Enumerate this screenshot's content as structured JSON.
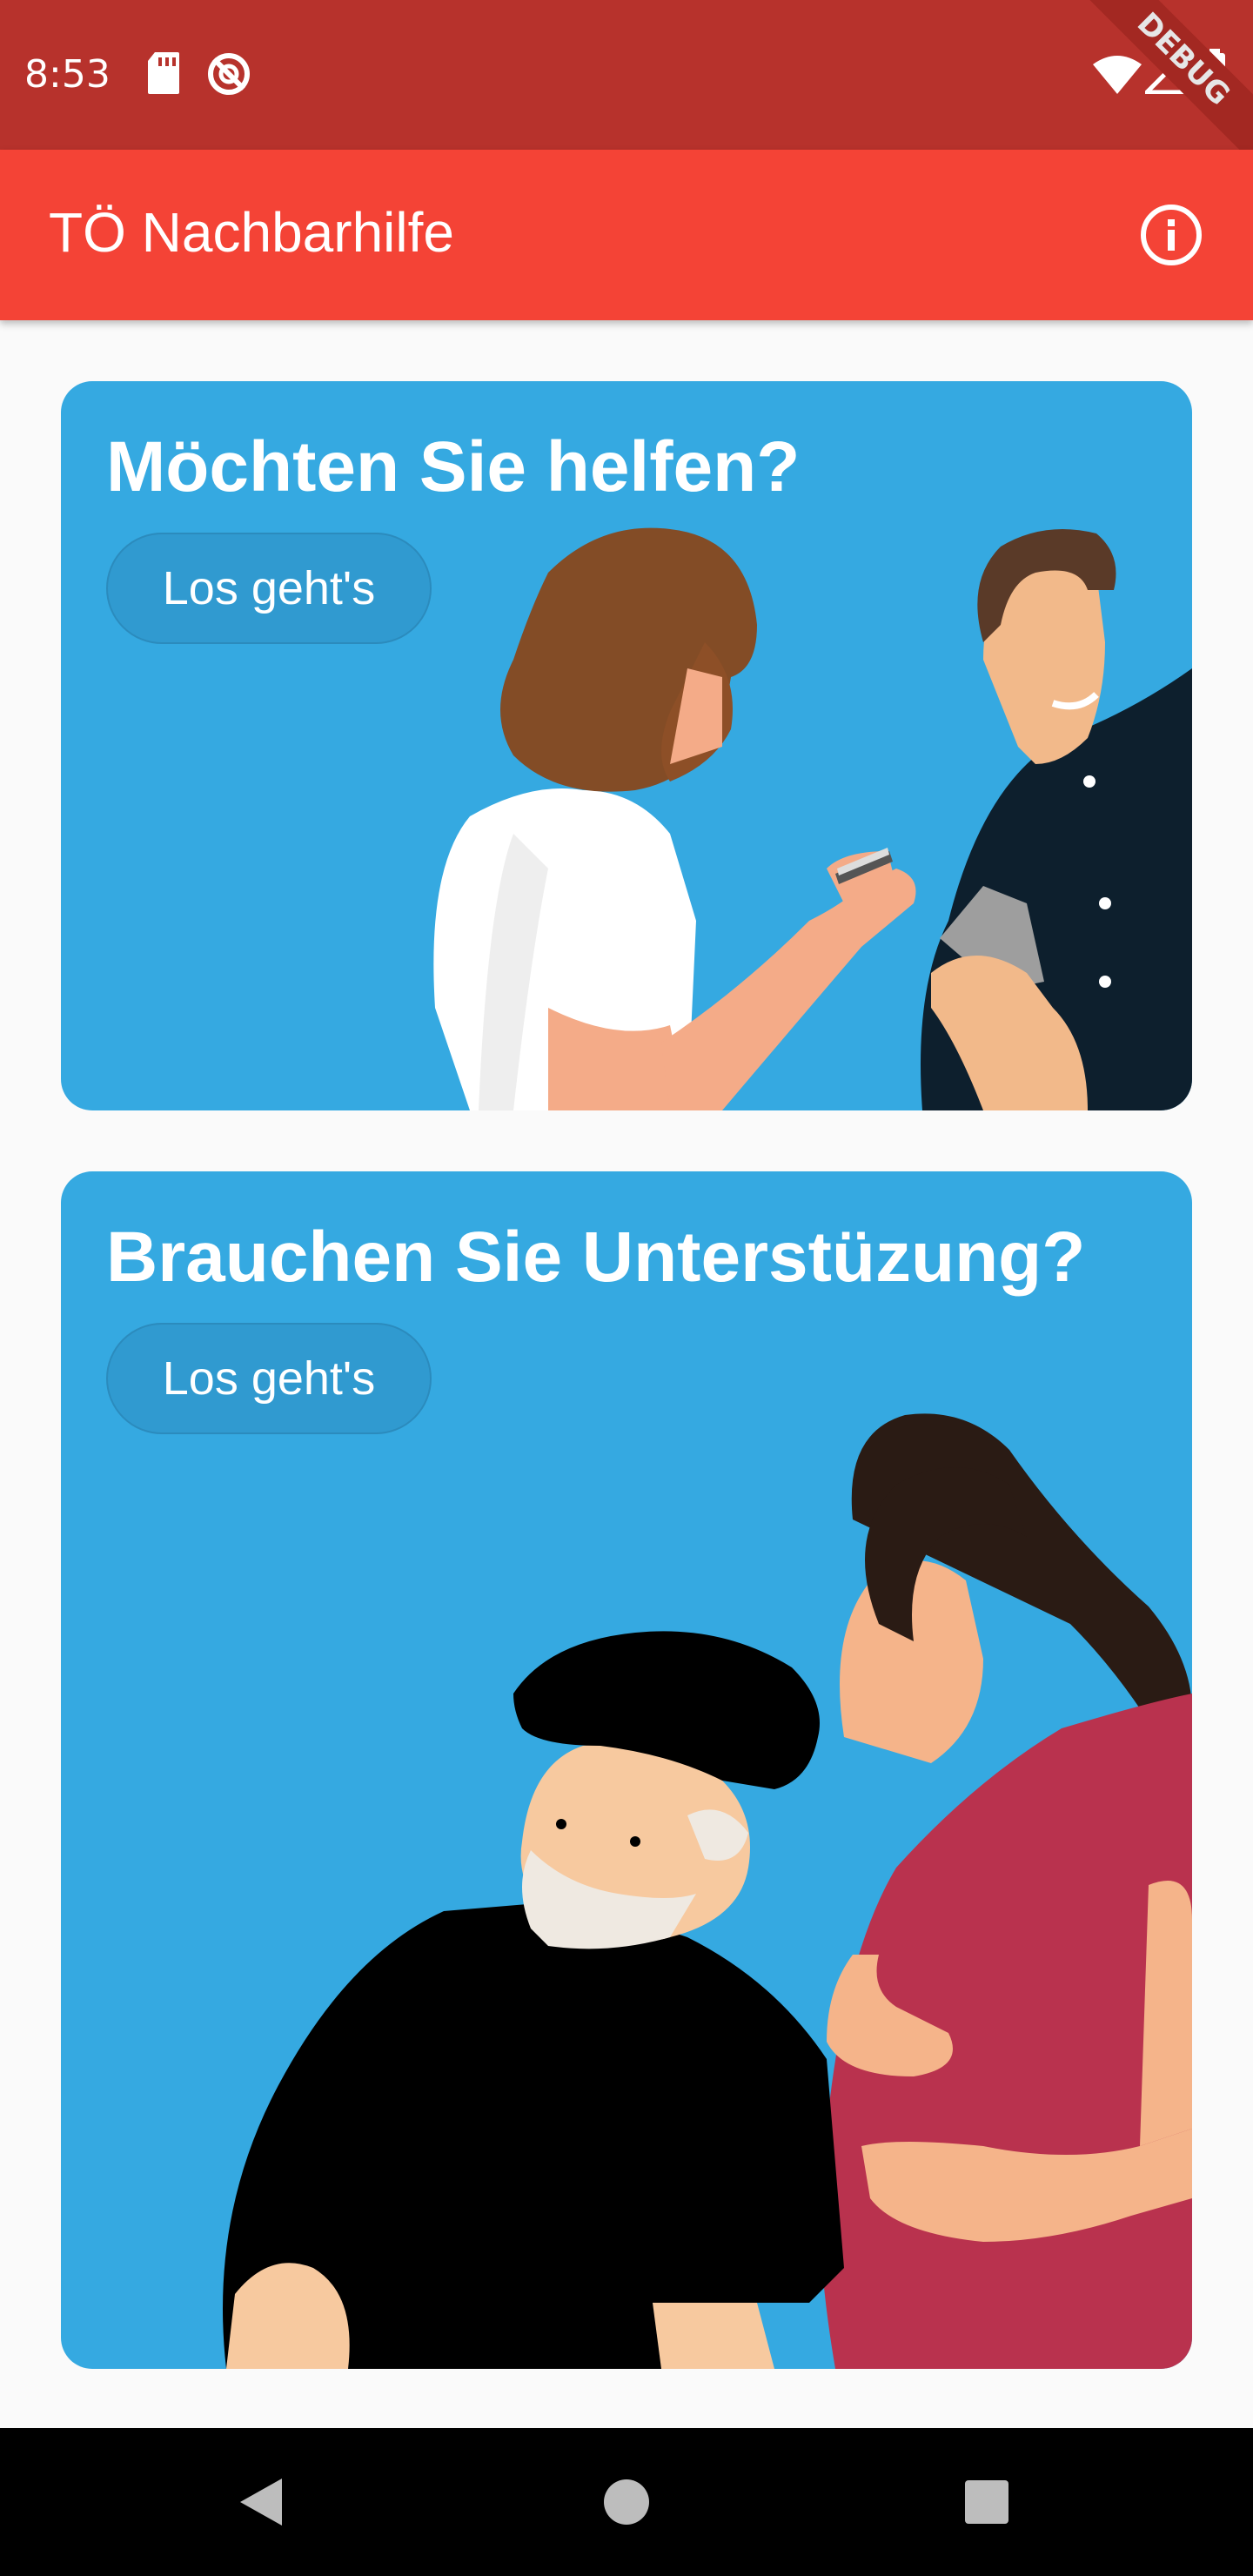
{
  "status_bar": {
    "time": "8:53",
    "icons": [
      "sd-card-icon",
      "no-sync-icon",
      "wifi-icon",
      "signal-icon",
      "battery-icon"
    ],
    "debug_label": "DEBUG",
    "color": "#b7322c"
  },
  "app_bar": {
    "title": "TÖ Nachbarhilfe",
    "action_icon": "info-icon",
    "color": "#f44336"
  },
  "cards": [
    {
      "title": "Möchten Sie helfen?",
      "button_label": "Los geht's"
    },
    {
      "title": "Brauchen Sie Unterstüzung?",
      "button_label": "Los geht's"
    }
  ],
  "colors": {
    "card_background": "#35a9e1",
    "page_background": "#fafafa"
  },
  "nav_bar": {
    "icons": [
      "back-icon",
      "home-icon",
      "recents-icon"
    ]
  }
}
